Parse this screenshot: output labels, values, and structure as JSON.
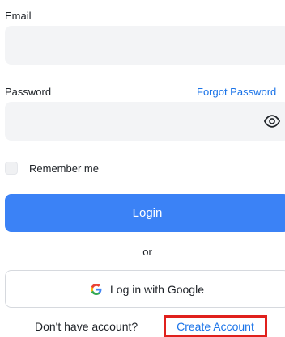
{
  "form": {
    "email": {
      "label": "Email",
      "value": "",
      "placeholder": ""
    },
    "password": {
      "label": "Password",
      "value": "",
      "placeholder": "",
      "forgot_link": "Forgot Password",
      "toggle_icon": "eye-icon"
    },
    "remember": {
      "label": "Remember me",
      "checked": false
    },
    "login_button": "Login",
    "divider_text": "or",
    "google_button": {
      "label": "Log in with Google",
      "icon": "google-icon"
    },
    "signup_prompt": "Don't have account?",
    "create_account_link": "Create Account"
  },
  "colors": {
    "primary": "#3b82f6",
    "link": "#1a73e8",
    "input_background": "#f3f4f6",
    "highlight_border": "#e0201c",
    "google_blue": "#4285F4",
    "google_red": "#EA4335",
    "google_yellow": "#FBBC05",
    "google_green": "#34A853"
  }
}
